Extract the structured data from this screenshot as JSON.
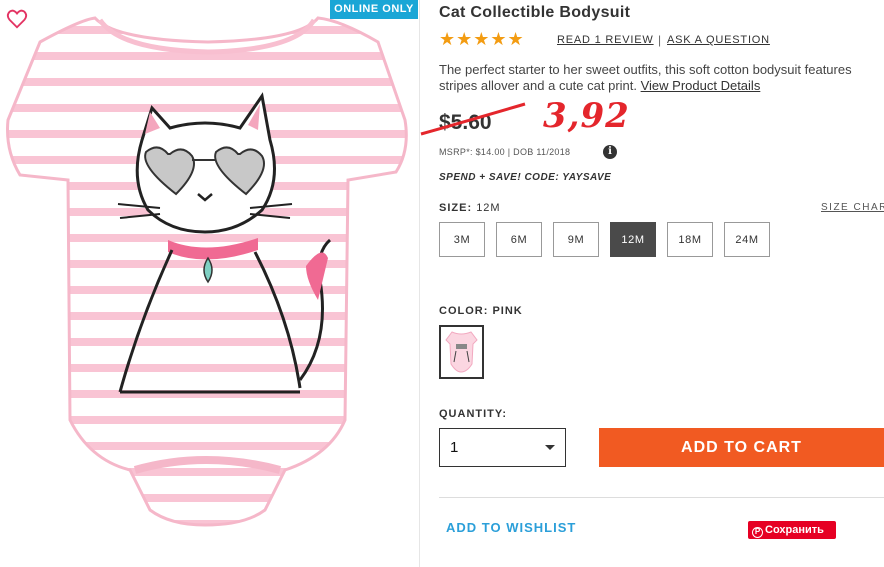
{
  "badge": "ONLINE ONLY",
  "product": {
    "title": "Cat Collectible Bodysuit",
    "stars": "★★★★★",
    "rating": 5,
    "review_link": "READ 1 REVIEW",
    "separator": "|",
    "question_link": "ASK A QUESTION",
    "description": "The perfect starter to her sweet outfits, this soft cotton bodysuit features stripes allover and a cute cat print. ",
    "details_link": "View Product Details",
    "old_price": "$5.60",
    "new_price": "3,92",
    "msrp": "MSRP*: $14.00 | DOB 11/2018",
    "info_icon": "i",
    "promo": "SPEND + SAVE! CODE: YAYSAVE"
  },
  "size": {
    "label": "SIZE:",
    "selected": "12M",
    "chart_link": "SIZE CHART",
    "options": [
      "3M",
      "6M",
      "9M",
      "12M",
      "18M",
      "24M"
    ]
  },
  "color": {
    "label": "COLOR:",
    "selected": "PINK"
  },
  "quantity": {
    "label": "QUANTITY:",
    "value": "1"
  },
  "actions": {
    "add_to_cart": "ADD TO CART",
    "add_to_wishlist": "ADD TO WISHLIST",
    "pinterest_save": "Сохранить"
  },
  "colors": {
    "badge_bg": "#1aa6d6",
    "stars": "#f39c12",
    "sale_price": "#e4262c",
    "cart_button": "#f15a22",
    "wishlist_link": "#2b9fd9",
    "pinterest": "#e60023",
    "selected_size": "#4a4a4a"
  },
  "icons": {
    "favorite": "heart-outline-icon",
    "info": "info-icon",
    "dropdown": "chevron-down-icon",
    "pinterest": "pinterest-icon"
  }
}
